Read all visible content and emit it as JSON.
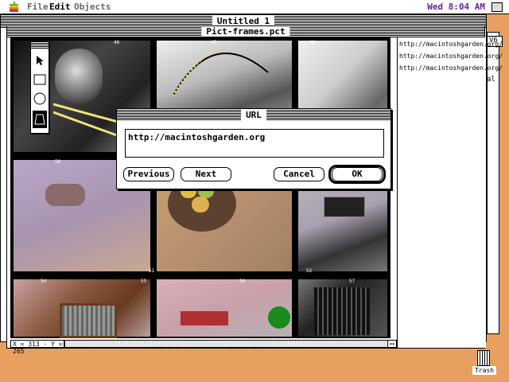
{
  "menubar": {
    "file": "File",
    "edit": "Edit",
    "objects": "Objects",
    "clock": "Wed 8:04 AM"
  },
  "back_window": {
    "title": "Untitled 1"
  },
  "stubs": {
    "v6": "V6",
    "al": "al"
  },
  "front_window": {
    "title": "Pict-frames.pct"
  },
  "frames": [
    {
      "num": "46"
    },
    {
      "num": "47"
    },
    {
      "num": "48"
    },
    {
      "num": "50"
    },
    {
      "num": "51"
    },
    {
      "num": "52"
    },
    {
      "num": "54"
    },
    {
      "num": "55"
    },
    {
      "num": "56"
    },
    {
      "num": "57"
    }
  ],
  "url_list": [
    "http://macintoshgarden.org/",
    "http://macintoshgarden.org/",
    "http://macintoshgarden.org/"
  ],
  "status": {
    "coord": "X = 313 · Y = 265"
  },
  "dialog": {
    "title": "URL",
    "url_value": "http://macintoshgarden.org",
    "previous": "Previous",
    "next": "Next",
    "cancel": "Cancel",
    "ok": "OK"
  },
  "desktop": {
    "trash": "Trash"
  },
  "colors": {
    "desktop": "#e8a060",
    "clock": "#6a1fa0"
  },
  "icons": [
    "apple-icon",
    "arrow-tool-icon",
    "rect-tool-icon",
    "oval-tool-icon",
    "lasso-tool-icon",
    "trash-icon"
  ]
}
